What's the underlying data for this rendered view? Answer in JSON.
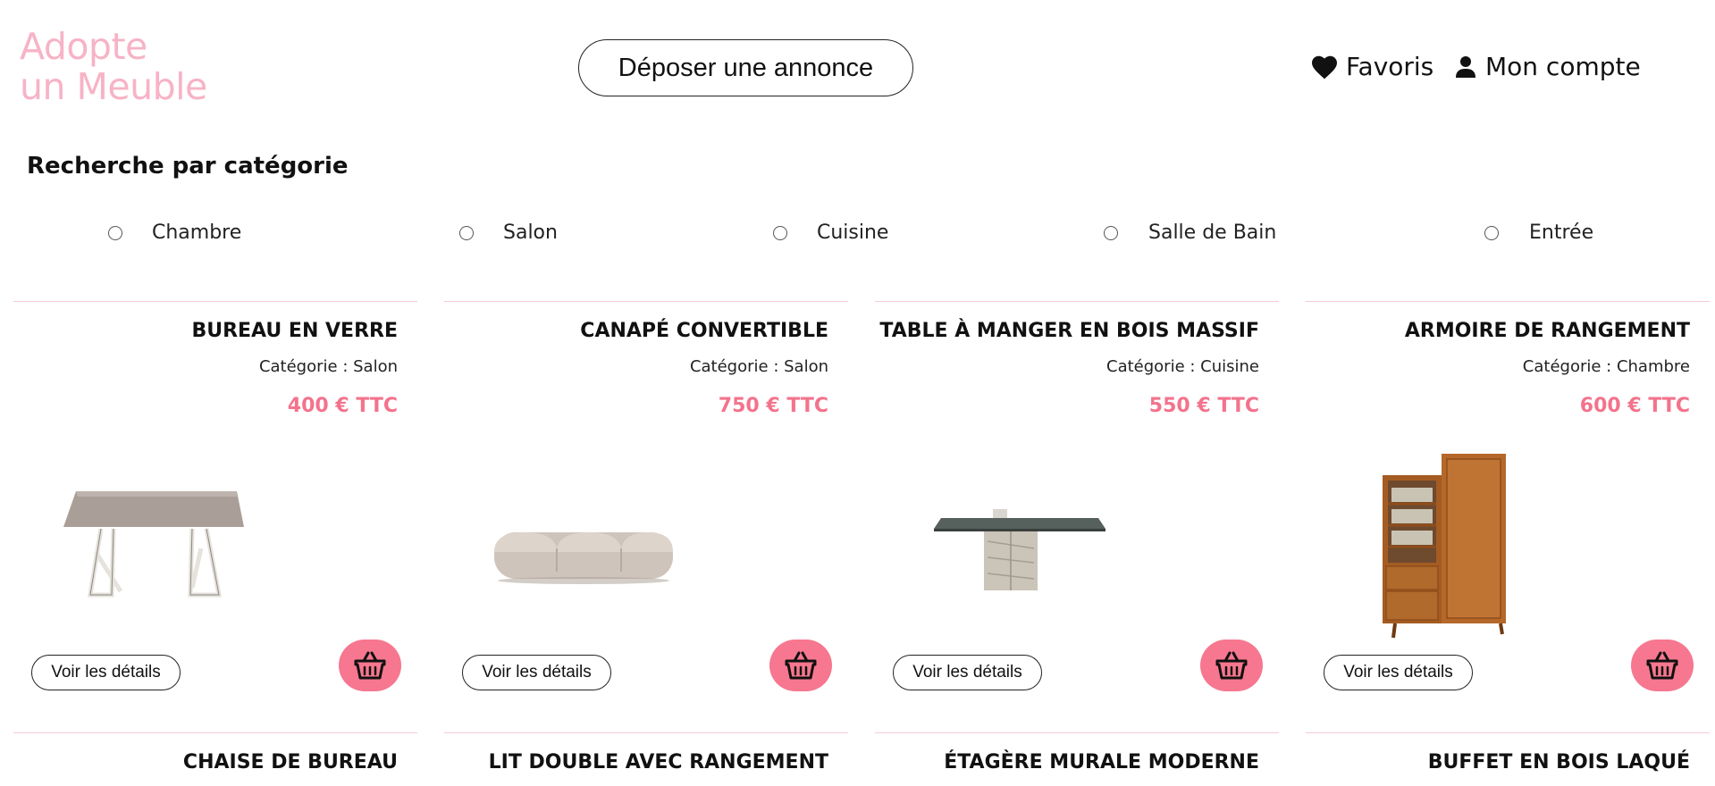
{
  "header": {
    "logo_line1": "Adopte",
    "logo_line2": "un Meuble",
    "post_button": "Déposer une annonce",
    "favorites_label": "Favoris",
    "favorites_icon": "heart-icon",
    "account_label": "Mon compte",
    "account_icon": "user-icon"
  },
  "categories": {
    "title": "Recherche par catégorie",
    "options": [
      "Chambre",
      "Salon",
      "Cuisine",
      "Salle de Bain",
      "Entrée"
    ]
  },
  "products": [
    {
      "title": "BUREAU EN VERRE",
      "category_label": "Catégorie : ",
      "category": "Salon",
      "price": "400 € TTC",
      "details_label": "Voir les détails",
      "cart_icon": "basket-icon"
    },
    {
      "title": "CANAPÉ CONVERTIBLE",
      "category_label": "Catégorie : ",
      "category": "Salon",
      "price": "750 € TTC",
      "details_label": "Voir les détails",
      "cart_icon": "basket-icon"
    },
    {
      "title": "TABLE À MANGER EN BOIS MASSIF",
      "category_label": "Catégorie : ",
      "category": "Cuisine",
      "price": "550 € TTC",
      "details_label": "Voir les détails",
      "cart_icon": "basket-icon"
    },
    {
      "title": "ARMOIRE DE RANGEMENT",
      "category_label": "Catégorie : ",
      "category": "Chambre",
      "price": "600 € TTC",
      "details_label": "Voir les détails",
      "cart_icon": "basket-icon"
    },
    {
      "title": "CHAISE DE BUREAU"
    },
    {
      "title": "LIT DOUBLE AVEC RANGEMENT"
    },
    {
      "title": "ÉTAGÈRE MURALE MODERNE"
    },
    {
      "title": "BUFFET EN BOIS LAQUÉ"
    }
  ],
  "colors": {
    "logo": "#f7b3c6",
    "price": "#f3738c",
    "cart_button": "#f6778f",
    "card_divider": "#f6c9d4"
  }
}
